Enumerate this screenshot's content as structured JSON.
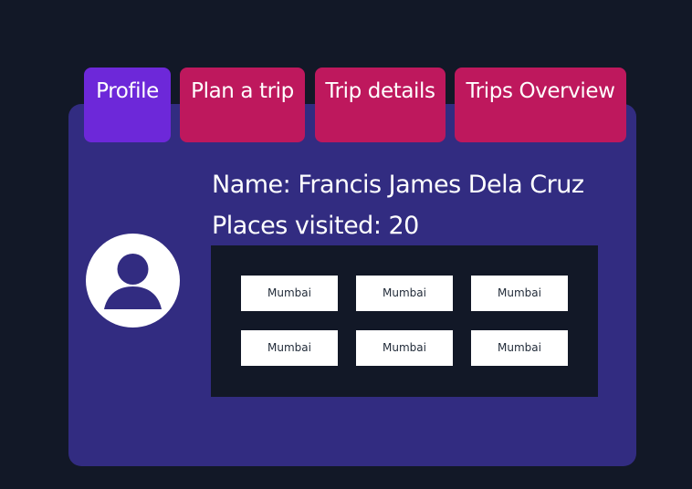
{
  "tabs": [
    {
      "label": "Profile",
      "active": true
    },
    {
      "label": "Plan a trip",
      "active": false
    },
    {
      "label": "Trip details",
      "active": false
    },
    {
      "label": "Trips Overview",
      "active": false
    }
  ],
  "profile": {
    "name_text": "Name: Francis James Dela Cruz",
    "places_text": "Places visited: 20",
    "avatar_icon": "user-avatar-icon"
  },
  "places": [
    "Mumbai",
    "Mumbai",
    "Mumbai",
    "Mumbai",
    "Mumbai",
    "Mumbai"
  ],
  "colors": {
    "page_background": "#121827",
    "card_background": "#322c81",
    "active_tab": "#6d28d9",
    "inactive_tab": "#be185d",
    "panel_background": "#121827",
    "chip_background": "#ffffff"
  }
}
